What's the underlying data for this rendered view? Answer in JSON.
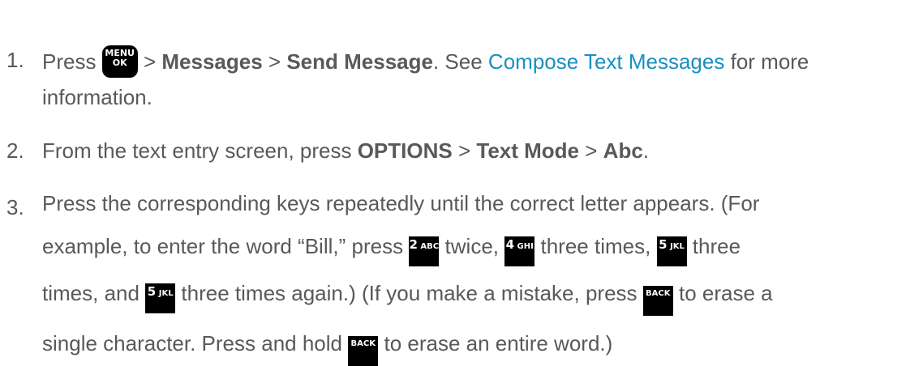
{
  "steps": [
    {
      "number": "1.",
      "press": "Press",
      "menu_key": {
        "line1": "MENU",
        "line2": "OK"
      },
      "sep1": ">",
      "messages": "Messages",
      "sep2": ">",
      "send_message": "Send Message",
      "see": ". See",
      "link_text": "Compose Text Messages",
      "tail": "for more",
      "tail2": "information."
    },
    {
      "number": "2.",
      "text1": "From the text entry screen, press",
      "options": "OPTIONS",
      "sep1": ">",
      "text_mode": "Text Mode",
      "sep2": ">",
      "abc": "Abc",
      "end": "."
    },
    {
      "number": "3.",
      "line1": "Press the corresponding keys repeatedly until the correct letter appears. (For",
      "line2a": "example, to enter the word “Bill,” press",
      "key2": {
        "digit": "2",
        "letters": "ABC"
      },
      "line2b": "twice,",
      "key4": {
        "digit": "4",
        "letters": "GHI"
      },
      "line2c": "three times,",
      "key5": {
        "digit": "5",
        "letters": "JKL"
      },
      "line2d": "three",
      "line3a": "times, and",
      "line3b": "three times again.) (If you make a mistake, press",
      "back_key": "BACK",
      "line3c": "to erase a",
      "line4a": "single character. Press and hold",
      "line4b": "to erase an entire word.)"
    }
  ]
}
